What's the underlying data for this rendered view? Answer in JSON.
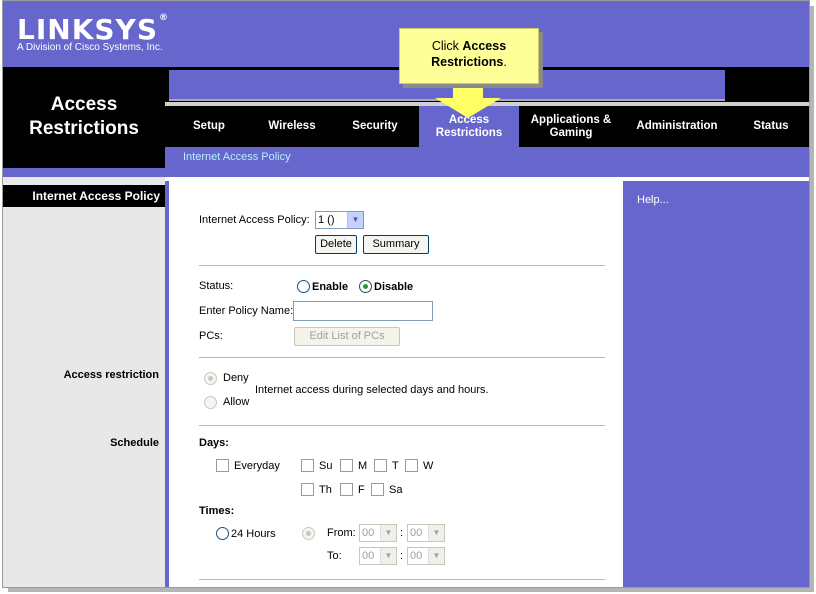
{
  "brand": {
    "logo": "LINKSYS",
    "registered": "®",
    "subtitle": "A Division of Cisco Systems, Inc."
  },
  "page_title": [
    "Access",
    "Restrictions"
  ],
  "tabs": [
    {
      "label": "Setup"
    },
    {
      "label": "Wireless"
    },
    {
      "label": "Security"
    },
    {
      "label": "Access\nRestrictions",
      "active": true
    },
    {
      "label": "Applications &\nGaming"
    },
    {
      "label": "Administration"
    },
    {
      "label": "Status"
    }
  ],
  "subnav": {
    "item": "Internet Access Policy"
  },
  "left": {
    "header": "Internet Access Policy",
    "access_restriction": "Access restriction",
    "schedule": "Schedule"
  },
  "help": {
    "label": "Help..."
  },
  "callout": {
    "prefix": "Click ",
    "emph": "Access",
    "line2": "Restrictions",
    "suffix": "."
  },
  "form": {
    "policy_label": "Internet Access Policy:",
    "policy_value": "1 ()",
    "delete_button": "Delete",
    "summary_button": "Summary",
    "status_label": "Status:",
    "enable_label": "Enable",
    "disable_label": "Disable",
    "status_selected": "Disable",
    "policy_name_label": "Enter Policy Name:",
    "policy_name_value": "",
    "pcs_label": "PCs:",
    "edit_pcs_button": "Edit List of PCs",
    "deny_label": "Deny",
    "allow_label": "Allow",
    "access_text": "Internet access during selected days and hours.",
    "days_label": "Days:",
    "everyday_label": "Everyday",
    "days": [
      "Su",
      "M",
      "T",
      "W",
      "Th",
      "F",
      "Sa"
    ],
    "times_label": "Times:",
    "hours24_label": "24 Hours",
    "from_label": "From:",
    "to_label": "To:",
    "from_hour": "00",
    "from_min": "00",
    "to_hour": "00",
    "to_min": "00",
    "time_sep": ":"
  },
  "colors": {
    "brand_purple": "#6666cc",
    "black": "#000000",
    "callout_yellow": "#ffff99",
    "subnav_text": "#b8f0ff"
  },
  "icons": [
    "dropdown-arrow-icon",
    "callout-arrow-icon"
  ]
}
